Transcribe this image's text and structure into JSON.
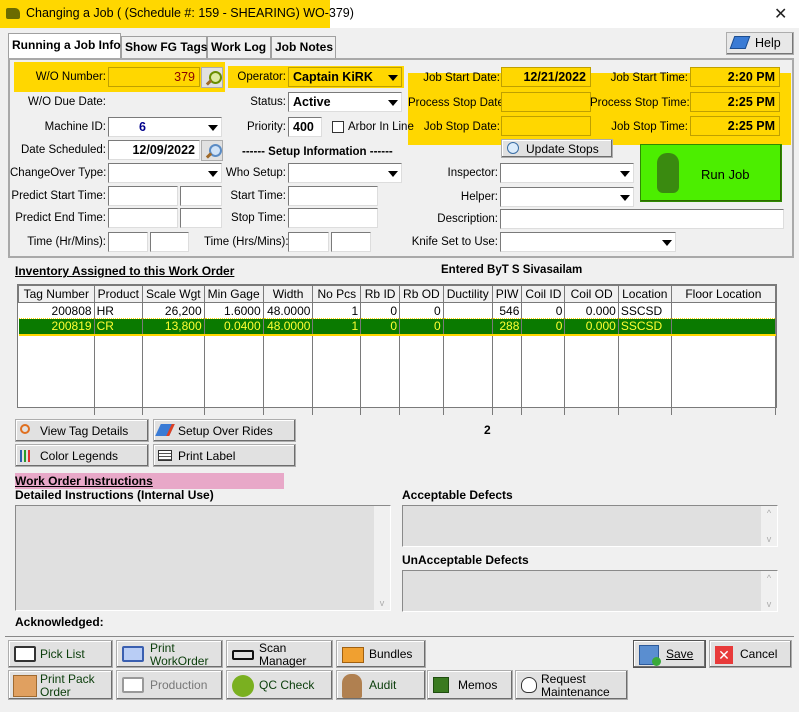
{
  "window": {
    "title": "Changing a Job  (  (Schedule #: 159 - SHEARING) WO-379)",
    "close_icon": "close-icon",
    "title_icon": "job-icon"
  },
  "tabs": [
    {
      "label": "Running a Job Info",
      "active": true
    },
    {
      "label": "Show FG Tags",
      "active": false
    },
    {
      "label": "Work Log",
      "active": false
    },
    {
      "label": "Job Notes",
      "active": false
    }
  ],
  "help_button": {
    "label": "Help",
    "icon": "help-book-icon"
  },
  "job_info": {
    "wo_number_label": "W/O Number:",
    "wo_number": "379",
    "wo_due_date_label": "W/O Due Date:",
    "wo_due_date": "",
    "machine_id_label": "Machine ID:",
    "machine_id": "6",
    "date_scheduled_label": "Date Scheduled:",
    "date_scheduled": "12/09/2022",
    "changeover_type_label": "ChangeOver Type:",
    "changeover_type": "",
    "predict_start_label": "Predict Start Time:",
    "predict_start_date": "",
    "predict_start_time": "",
    "predict_end_label": "Predict End Time:",
    "predict_end_date": "",
    "predict_end_time": "",
    "time_hr_mins_label": "Time (Hr/Mins):",
    "time_hr": "",
    "time_mins": "",
    "operator_label": "Operator:",
    "operator": "Captain KiRK",
    "status_label": "Status:",
    "status": "Active",
    "priority_label": "Priority:",
    "priority": "400",
    "arbor_in_line_label": "Arbor In Line",
    "arbor_in_line_checked": false,
    "setup_information_heading": "------  Setup Information  ------",
    "who_setup_label": "Who Setup:",
    "who_setup": "",
    "setup_start_time_label": "Start Time:",
    "setup_start_time": "",
    "setup_stop_time_label": "Stop Time:",
    "setup_stop_time": "",
    "setup_time_hrs_mins_label": "Time (Hrs/Mins):",
    "setup_time_hrs": "",
    "setup_time_mins": "",
    "job_start_date_label": "Job Start Date:",
    "job_start_date": "12/21/2022",
    "process_stop_date_label": "Process Stop Date",
    "process_stop_date": "",
    "job_stop_date_label": "Job Stop Date:",
    "job_stop_date": "",
    "job_start_time_label": "Job Start Time:",
    "job_start_time": "2:20 PM",
    "process_stop_time_label": "Process Stop Time:",
    "process_stop_time": "2:25 PM",
    "job_stop_time_label": "Job Stop Time:",
    "job_stop_time": "2:25 PM",
    "update_stops_label": "Update Stops",
    "run_job_label": "Run Job",
    "inspector_label": "Inspector:",
    "inspector": "",
    "helper_label": "Helper:",
    "helper": "",
    "description_label": "Description:",
    "description": "",
    "knife_set_label": "Knife Set to Use:",
    "knife_set": ""
  },
  "inventory": {
    "heading": "Inventory Assigned to this Work Order",
    "entered_by": "Entered ByT S Sivasailam",
    "columns": [
      "Tag Number",
      "Product",
      "Scale Wgt",
      "Min Gage",
      "Width",
      "No Pcs",
      "Rb ID",
      "Rb OD",
      "Ductility",
      "PIW",
      "Coil ID",
      "Coil OD",
      "Location",
      "Floor Location"
    ],
    "rows": [
      {
        "selected": false,
        "cells": [
          "200808",
          "HR",
          "26,200",
          "1.6000",
          "48.0000",
          "1",
          "0",
          "0",
          "",
          "546",
          "0",
          "0.000",
          "SSCSD",
          ""
        ]
      },
      {
        "selected": true,
        "cells": [
          "200819",
          "CR",
          "13,800",
          "0.0400",
          "48.0000",
          "1",
          "0",
          "0",
          "",
          "288",
          "0",
          "0.000",
          "SSCSD",
          ""
        ]
      }
    ],
    "row_count": "2"
  },
  "grid_buttons": {
    "view_tag_details": "View Tag Details",
    "setup_over_rides": "Setup Over Rides",
    "color_legends": "Color Legends",
    "print_label": "Print Label"
  },
  "instructions": {
    "heading": "Work Order Instructions",
    "detailed_label": "Detailed Instructions (Internal Use)",
    "detailed_value": "",
    "acceptable_label": "Acceptable Defects",
    "acceptable_value": "",
    "unacceptable_label": "UnAcceptable Defects",
    "unacceptable_value": "",
    "acknowledged_label": "Acknowledged:"
  },
  "bottom_buttons": {
    "pick_list": "Pick List",
    "print_workorder_1": "Print",
    "print_workorder_2": "WorkOrder",
    "scan_manager_1": "Scan",
    "scan_manager_2": "Manager",
    "bundles": "Bundles",
    "print_pack_order_1": "Print Pack",
    "print_pack_order_2": "Order",
    "production": "Production",
    "qc_check": "QC Check",
    "audit": "Audit",
    "memos": "Memos",
    "request_maintenance_1": "Request",
    "request_maintenance_2": "Maintenance",
    "save": "Save",
    "cancel": "Cancel"
  },
  "colors": {
    "highlight_yellow": "#ffd700",
    "run_job_green": "#4cee00",
    "selected_row_bg": "#0a7a00",
    "selected_row_text": "#ffff33",
    "instructions_heading_bg": "#e8a8c8",
    "wo_number_text": "#8b0000",
    "machine_id_text": "#00008b"
  }
}
